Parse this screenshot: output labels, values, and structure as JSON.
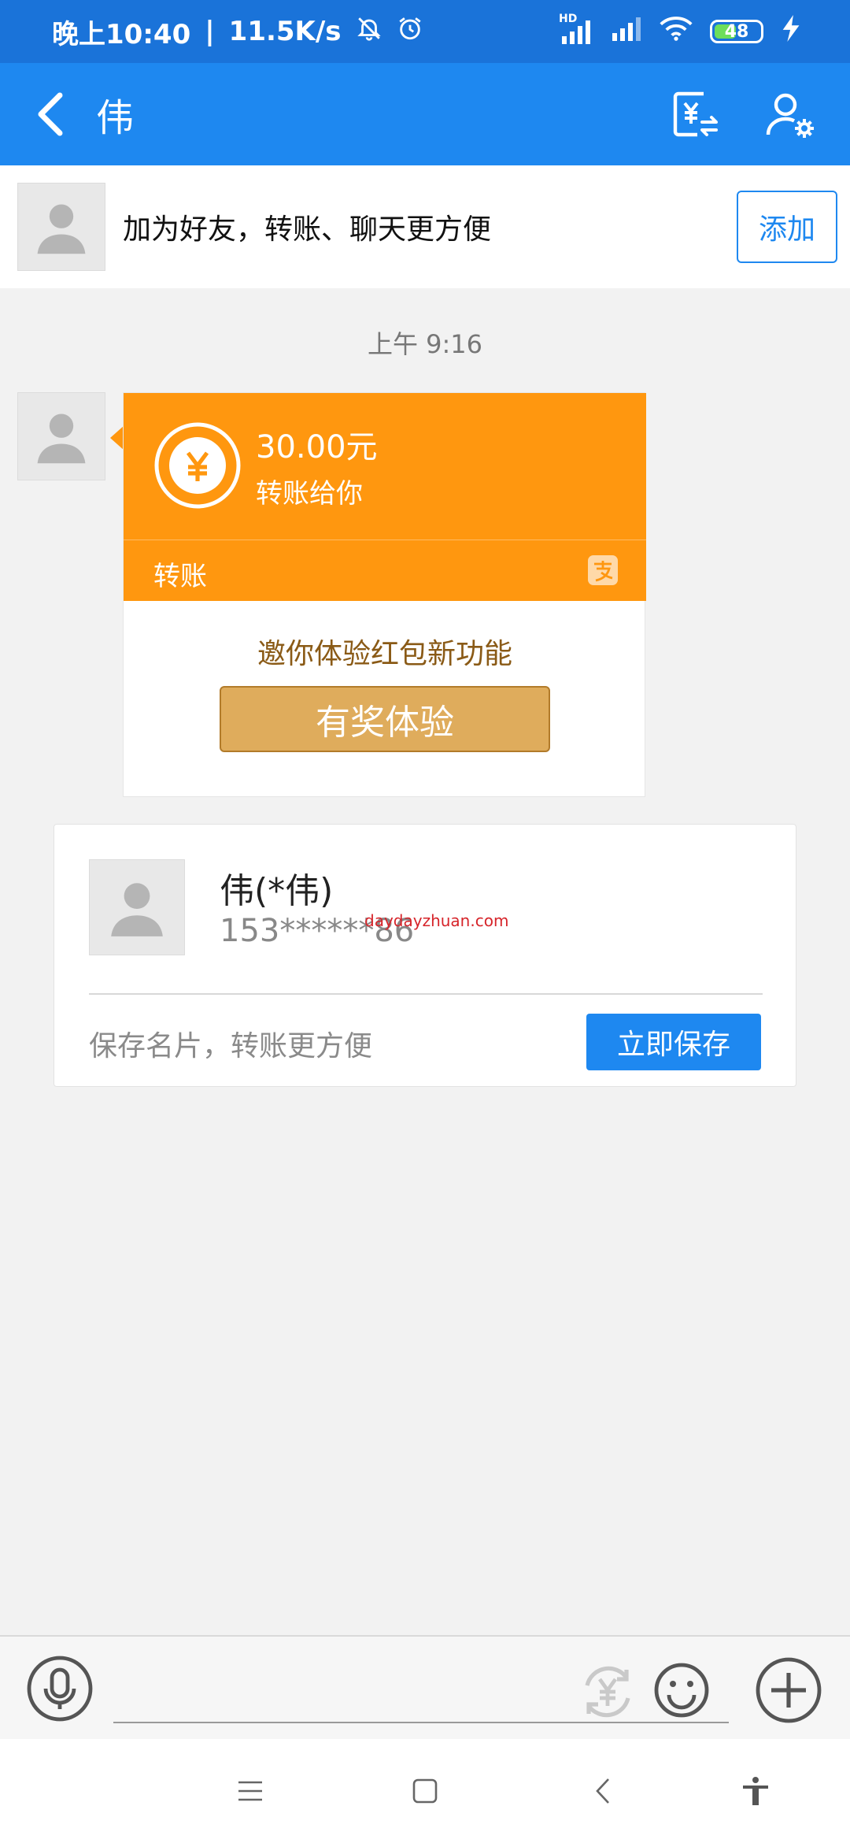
{
  "status_bar": {
    "time": "晚上10:40",
    "network_speed": "11.5K/s",
    "battery": "48",
    "signal_label": "HD"
  },
  "header": {
    "title": "伟"
  },
  "add_friend": {
    "prompt": "加为好友，转账、聊天更方便",
    "button": "添加"
  },
  "chat": {
    "timestamp": "上午 9:16",
    "transfer": {
      "amount": "30.00元",
      "description": "转账给你",
      "label": "转账",
      "promo_text": "邀你体验红包新功能",
      "promo_button": "有奖体验"
    },
    "contact_card": {
      "name": "伟(*伟)",
      "phone": "153******86",
      "watermark": "daydayzhuan.com",
      "hint": "保存名片，转账更方便",
      "save_button": "立即保存"
    }
  },
  "colors": {
    "header_blue": "#1e88f0",
    "transfer_orange": "#ff970f",
    "promo_gold": "#dfac5c"
  }
}
